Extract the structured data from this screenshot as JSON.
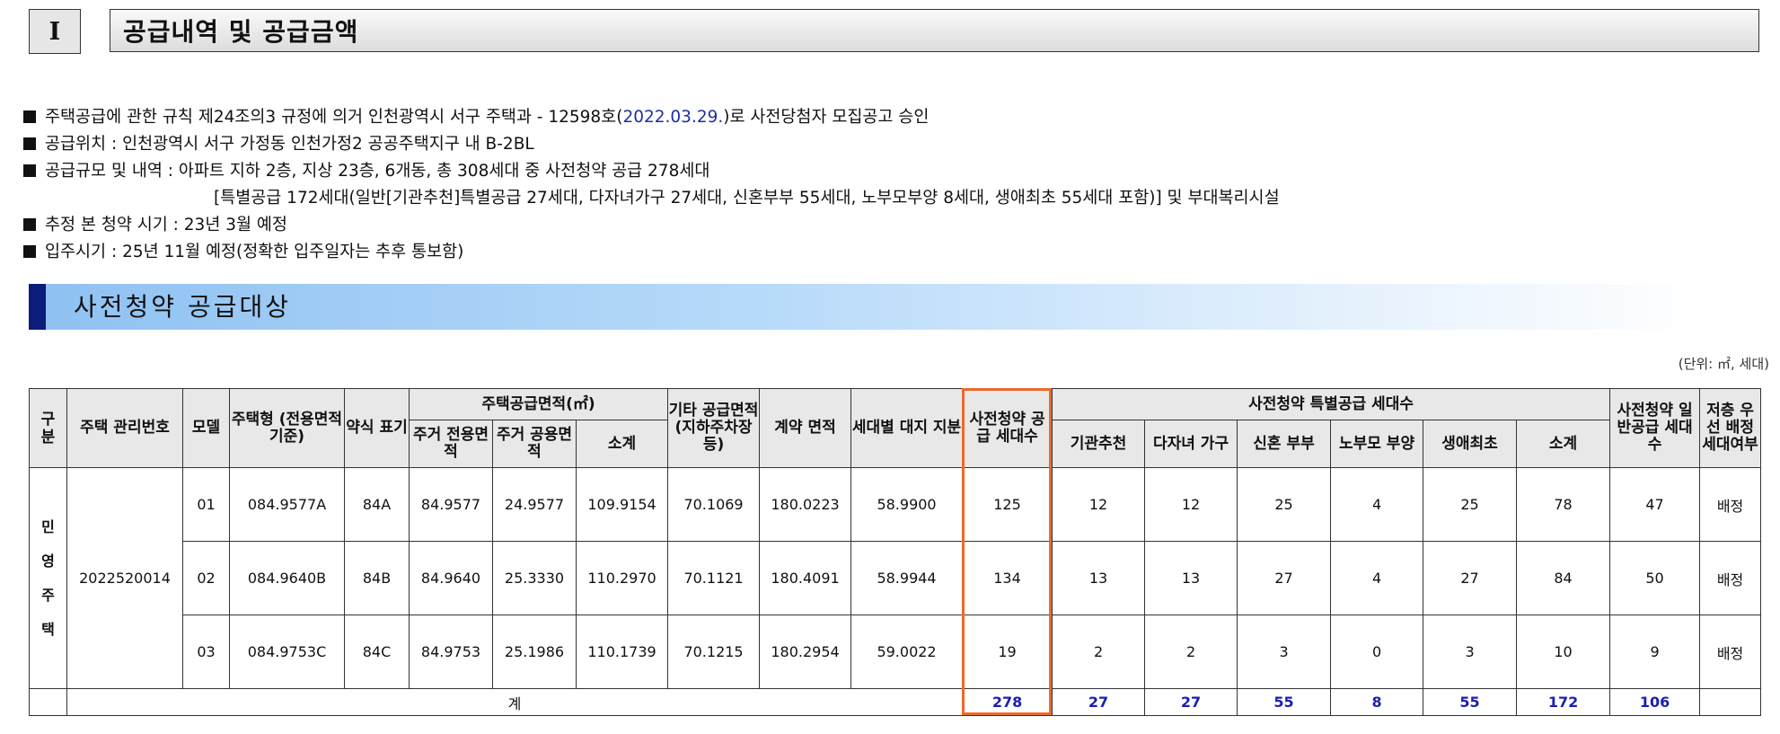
{
  "section": {
    "number": "I",
    "title": "공급내역 및 공급금액"
  },
  "bullets": [
    {
      "pre": "주택공급에 관한 규칙 제24조의3 규정에 의거 인천광역시 서구 주택과 - 12598호(",
      "date": "2022.03.29.",
      "post": ")로 사전당첨자 모집공고 승인"
    },
    {
      "text": "공급위치 : 인천광역시 서구 가정동 인천가정2 공공주택지구 내 B-2BL"
    },
    {
      "text": "공급규모 및 내역 : 아파트 지하 2층, 지상 23층, 6개동, 총 308세대 중 사전청약 공급 278세대"
    },
    {
      "text": "[특별공급 172세대(일반[기관추천]특별공급 27세대, 다자녀가구 27세대, 신혼부부 55세대, 노부모부양 8세대, 생애최초 55세대 포함)] 및 부대복리시설"
    },
    {
      "text": "추정 본 청약 시기 : 23년 3월 예정"
    },
    {
      "text": "입주시기 : 25년 11월 예정(정확한 입주일자는 추후 통보함)"
    }
  ],
  "subheading": "사전청약 공급대상",
  "unit": "(단위: ㎡, 세대)",
  "table": {
    "headers": {
      "gubun": "구분",
      "mgmt": "주택 관리번호",
      "model": "모델",
      "type": "주택형 (전용면적 기준)",
      "abbr": "약식 표기",
      "supply_area": "주택공급면적(㎡)",
      "exclusive": "주거 전용면적",
      "common": "주거 공용면적",
      "subtotal": "소계",
      "other": "기타 공급면적 (지하주차장 등)",
      "contract": "계약 면적",
      "land": "세대별 대지 지분",
      "pre_supply": "사전청약 공급 세대수",
      "special": "사전청약 특별공급 세대수",
      "agency": "기관추천",
      "multi": "다자녀 가구",
      "newly": "신혼 부부",
      "elderly": "노부모 부양",
      "first": "생애최초",
      "special_sub": "소계",
      "general": "사전청약 일반공급 세대수",
      "low_floor": "저층 우선 배정세대여부"
    },
    "category": "민영주택",
    "mgmt_no": "2022520014",
    "rows": [
      {
        "model": "01",
        "type": "084.9577A",
        "abbr": "84A",
        "exclusive": "84.9577",
        "common": "24.9577",
        "subtotal": "109.9154",
        "other": "70.1069",
        "contract": "180.0223",
        "land": "58.9900",
        "pre": "125",
        "agency": "12",
        "multi": "12",
        "newly": "25",
        "elderly": "4",
        "first": "25",
        "sp_sub": "78",
        "general": "47",
        "low": "배정"
      },
      {
        "model": "02",
        "type": "084.9640B",
        "abbr": "84B",
        "exclusive": "84.9640",
        "common": "25.3330",
        "subtotal": "110.2970",
        "other": "70.1121",
        "contract": "180.4091",
        "land": "58.9944",
        "pre": "134",
        "agency": "13",
        "multi": "13",
        "newly": "27",
        "elderly": "4",
        "first": "27",
        "sp_sub": "84",
        "general": "50",
        "low": "배정"
      },
      {
        "model": "03",
        "type": "084.9753C",
        "abbr": "84C",
        "exclusive": "84.9753",
        "common": "25.1986",
        "subtotal": "110.1739",
        "other": "70.1215",
        "contract": "180.2954",
        "land": "59.0022",
        "pre": "19",
        "agency": "2",
        "multi": "2",
        "newly": "3",
        "elderly": "0",
        "first": "3",
        "sp_sub": "10",
        "general": "9",
        "low": "배정"
      }
    ],
    "total": {
      "label": "계",
      "pre": "278",
      "agency": "27",
      "multi": "27",
      "newly": "55",
      "elderly": "8",
      "first": "55",
      "sp_sub": "172",
      "general": "106"
    }
  }
}
